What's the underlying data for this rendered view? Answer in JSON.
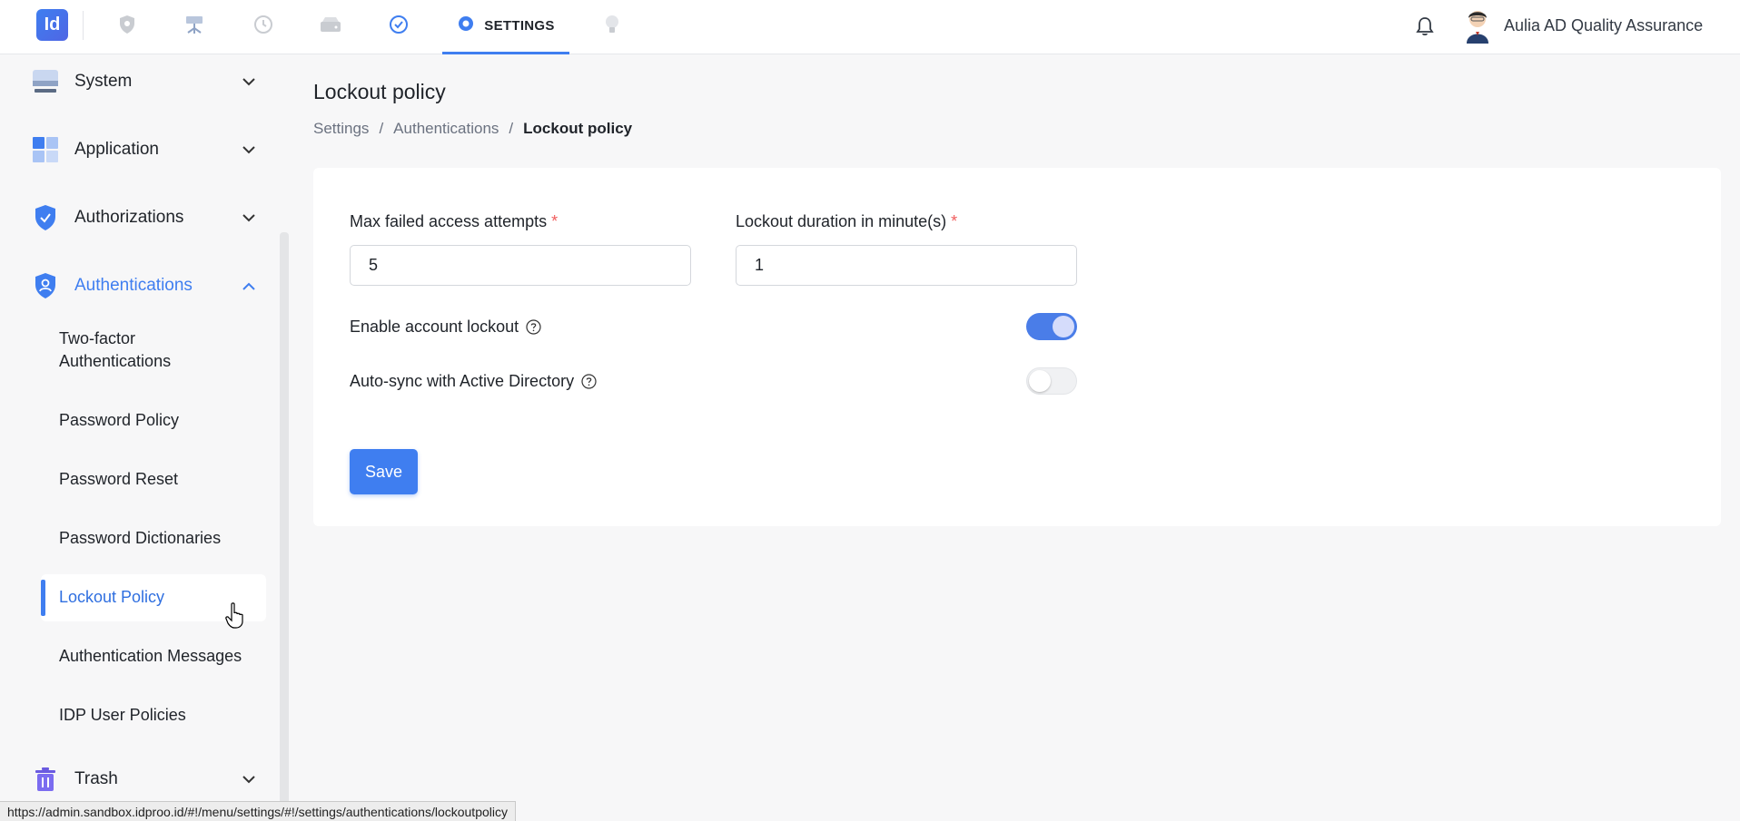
{
  "header": {
    "logo_text": "Id",
    "active_tab_label": "SETTINGS",
    "user_name": "Aulia AD Quality Assurance",
    "accent_color": "#3f7ef0"
  },
  "nav_icons": [
    "shield-icon",
    "network-icon",
    "history-icon",
    "drive-icon",
    "check-circle-icon",
    "settings-gear-icon",
    "lightbulb-icon"
  ],
  "sidebar": {
    "groups": [
      {
        "label": "System",
        "icon": "monitor-icon",
        "expanded": false
      },
      {
        "label": "Application",
        "icon": "grid-icon",
        "expanded": false
      },
      {
        "label": "Authorizations",
        "icon": "shield-check-icon",
        "expanded": false
      },
      {
        "label": "Authentications",
        "icon": "shield-user-icon",
        "expanded": true
      }
    ],
    "sub_items": [
      {
        "label_line1": "Two-factor",
        "label_line2": "Authentications"
      },
      {
        "label": "Password Policy"
      },
      {
        "label": "Password Reset"
      },
      {
        "label": "Password Dictionaries"
      },
      {
        "label": "Lockout Policy",
        "active": true
      },
      {
        "label": "Authentication Messages"
      },
      {
        "label": "IDP User Policies"
      }
    ],
    "trash_label": "Trash"
  },
  "main": {
    "title": "Lockout policy",
    "breadcrumb": [
      "Settings",
      "Authentications",
      "Lockout policy"
    ],
    "form": {
      "max_attempts_label": "Max failed access attempts",
      "max_attempts_value": "5",
      "lockout_duration_label": "Lockout duration in minute(s)",
      "lockout_duration_value": "1",
      "required_mark": "*",
      "enable_lockout_label": "Enable account lockout",
      "enable_lockout_on": true,
      "autosync_label": "Auto-sync with Active Directory",
      "autosync_on": false,
      "save_label": "Save"
    }
  },
  "status_bar": {
    "url": "https://admin.sandbox.idproo.id/#!/menu/settings/#!/settings/authentications/lockoutpolicy"
  }
}
